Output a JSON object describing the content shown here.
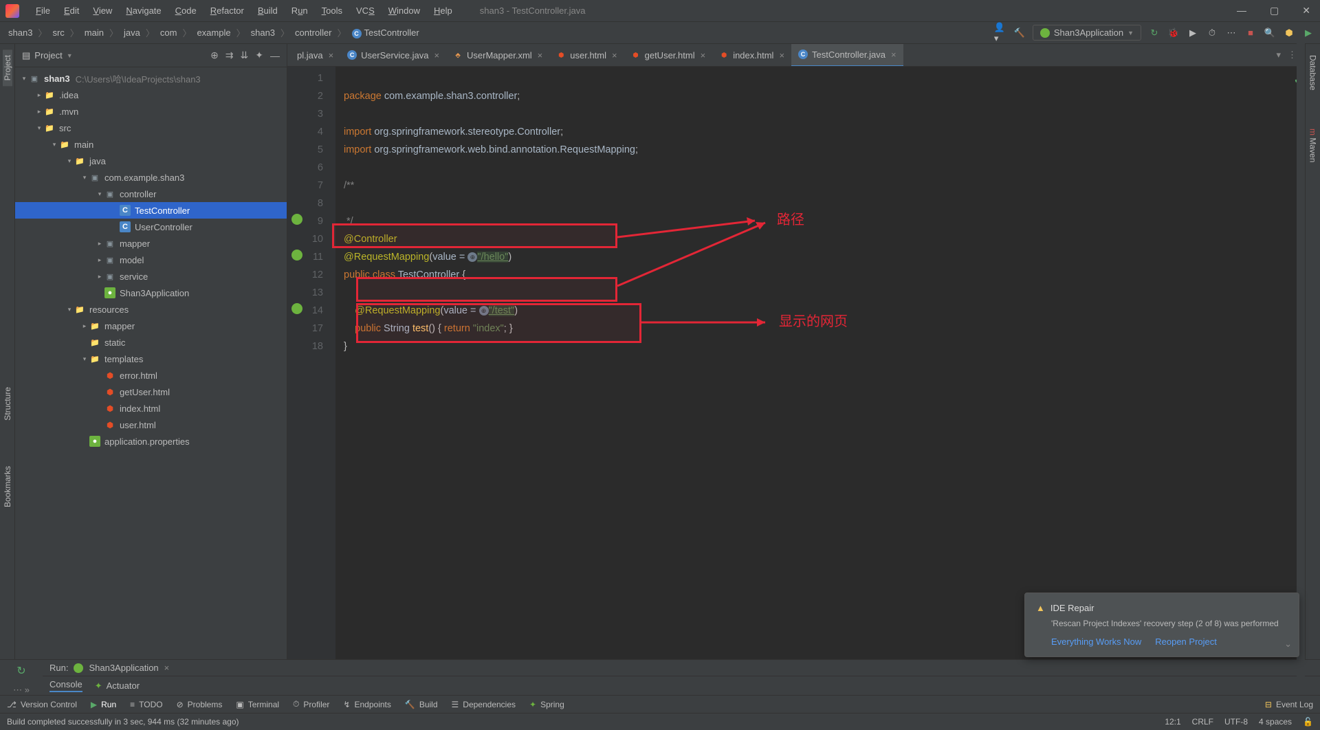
{
  "window_title": "shan3 - TestController.java",
  "menus": [
    "File",
    "Edit",
    "View",
    "Navigate",
    "Code",
    "Refactor",
    "Build",
    "Run",
    "Tools",
    "VCS",
    "Window",
    "Help"
  ],
  "breadcrumbs": [
    "shan3",
    "src",
    "main",
    "java",
    "com",
    "example",
    "shan3",
    "controller",
    "TestController"
  ],
  "run_config": "Shan3Application",
  "project_panel_title": "Project",
  "project_root": "shan3",
  "project_root_path": "C:\\Users\\哈\\IdeaProjects\\shan3",
  "tree": {
    "idea": ".idea",
    "mvn": ".mvn",
    "src": "src",
    "main": "main",
    "java": "java",
    "pkg_root": "com.example.shan3",
    "pkg_controller": "controller",
    "cls_test": "TestController",
    "cls_user": "UserController",
    "pkg_mapper": "mapper",
    "pkg_model": "model",
    "pkg_service": "service",
    "cls_app": "Shan3Application",
    "resources": "resources",
    "res_mapper": "mapper",
    "res_static": "static",
    "res_templates": "templates",
    "html_error": "error.html",
    "html_getUser": "getUser.html",
    "html_index": "index.html",
    "html_user": "user.html",
    "app_props": "application.properties"
  },
  "tabs": [
    {
      "label": "pl.java",
      "type": "java"
    },
    {
      "label": "UserService.java",
      "type": "java"
    },
    {
      "label": "UserMapper.xml",
      "type": "xml"
    },
    {
      "label": "user.html",
      "type": "html"
    },
    {
      "label": "getUser.html",
      "type": "html"
    },
    {
      "label": "index.html",
      "type": "html"
    },
    {
      "label": "TestController.java",
      "type": "java",
      "active": true
    }
  ],
  "line_numbers": [
    "1",
    "2",
    "3",
    "4",
    "5",
    "6",
    "7",
    "8",
    "9",
    "10",
    "11",
    "12",
    "13",
    "14",
    "17",
    "18"
  ],
  "code": {
    "package_kw": "package",
    "package_name": "com.example.shan3.controller",
    "import_kw": "import",
    "import1": "org.springframework.stereotype.Controller",
    "import2": "org.springframework.web.bind.annotation.RequestMapping",
    "comment_open": "/**",
    "comment_close": " */",
    "ann_controller": "@Controller",
    "ann_reqmap": "@RequestMapping",
    "value_eq": "value = ",
    "str_hello": "\"/hello\"",
    "public_kw": "public",
    "class_kw": "class",
    "class_name": "TestController",
    "str_test": "\"/test\"",
    "string_type": "String",
    "method_name": "test",
    "return_kw": "return",
    "str_index": "\"index\""
  },
  "annotations": {
    "label1": "路径",
    "label2": "显示的网页"
  },
  "run_panel": {
    "title": "Run:",
    "config": "Shan3Application",
    "tab_console": "Console",
    "tab_actuator": "Actuator"
  },
  "notification": {
    "title": "IDE Repair",
    "body": "'Rescan Project Indexes' recovery step (2 of 8) was performed",
    "action1": "Everything Works Now",
    "action2": "Reopen Project"
  },
  "bottom_tools": [
    "Version Control",
    "Run",
    "TODO",
    "Problems",
    "Terminal",
    "Profiler",
    "Endpoints",
    "Build",
    "Dependencies",
    "Spring"
  ],
  "event_log": "Event Log",
  "status_message": "Build completed successfully in 3 sec, 944 ms (32 minutes ago)",
  "status_right": {
    "pos": "12:1",
    "le": "CRLF",
    "enc": "UTF-8",
    "indent": "4 spaces"
  },
  "right_stripe": {
    "db": "Database",
    "mvn": "Maven"
  },
  "left_stripe": {
    "project": "Project",
    "structure": "Structure",
    "bookmarks": "Bookmarks"
  }
}
